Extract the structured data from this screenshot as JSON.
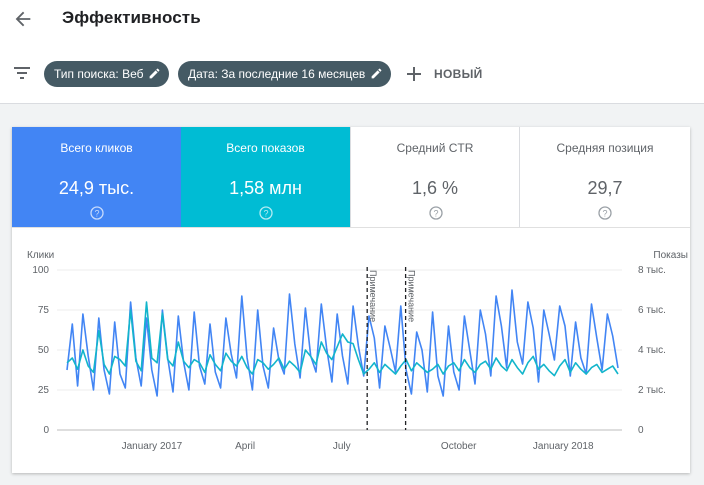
{
  "header": {
    "title": "Эффективность",
    "back_icon": "arrow-back-icon"
  },
  "filters": {
    "chips": [
      {
        "label": "Тип поиска: Веб"
      },
      {
        "label": "Дата: За последние 16 месяцев"
      }
    ],
    "new_label": "НОВЫЙ"
  },
  "metrics": [
    {
      "label": "Всего кликов",
      "value": "24,9 тыс.",
      "color": "#4285f4"
    },
    {
      "label": "Всего показов",
      "value": "1,58 млн",
      "color": "#00bcd4"
    },
    {
      "label": "Средний CTR",
      "value": "1,6 %"
    },
    {
      "label": "Средняя позиция",
      "value": "29,7"
    }
  ],
  "chart_data": {
    "type": "line",
    "left_axis_label": "Клики",
    "right_axis_label": "Показы",
    "left_ticks": [
      "100",
      "75",
      "50",
      "25",
      "0"
    ],
    "right_ticks": [
      "8 тыс.",
      "6 тыс.",
      "4 тыс.",
      "2 тыс.",
      "0"
    ],
    "ylim_left": [
      0,
      100
    ],
    "ylim_right": [
      0,
      8000
    ],
    "x_tick_labels": [
      "January 2017",
      "April",
      "July",
      "October",
      "January 2018"
    ],
    "annotations": [
      "Примечание",
      "Примечание"
    ],
    "grid": true,
    "series": [
      {
        "axis": "right",
        "color": "#4285f4",
        "values_sampled": [
          3000,
          5300,
          2200,
          5800,
          3700,
          2000,
          5600,
          3000,
          1800,
          5400,
          2800,
          2100,
          6400,
          3600,
          2200,
          5600,
          3000,
          1700,
          6000,
          3600,
          1900,
          5700,
          3400,
          2000,
          5900,
          3200,
          2300,
          5300,
          2900,
          2100,
          5600,
          3800,
          2600,
          6700,
          3600,
          2000,
          6000,
          3200,
          2100,
          5100,
          3500,
          2800,
          6800,
          4300,
          2600,
          6100,
          3700,
          2900,
          6300,
          4100,
          2400,
          5800,
          3700,
          2300,
          6200,
          4200,
          2700,
          5700,
          4600,
          2100,
          5200,
          4100,
          2900,
          6200,
          3000,
          1800,
          4900,
          4000,
          1900,
          5900,
          2700,
          1700,
          5200,
          2900,
          2000,
          5700,
          4000,
          2300,
          6000,
          4800,
          2700,
          6700,
          5200,
          3100,
          7000,
          4400,
          3300,
          6400,
          5100,
          2400,
          6000,
          4800,
          3500,
          6200,
          5200,
          2700,
          5400,
          3600,
          2800,
          6300,
          4600,
          3000,
          5800,
          4700,
          3100
        ]
      },
      {
        "axis": "left",
        "color": "#12b5cb",
        "values_sampled": [
          42,
          45,
          38,
          50,
          40,
          36,
          62,
          41,
          35,
          46,
          44,
          40,
          75,
          43,
          37,
          80,
          45,
          42,
          73,
          44,
          40,
          55,
          43,
          39,
          44,
          42,
          36,
          47,
          41,
          37,
          48,
          43,
          40,
          46,
          39,
          35,
          44,
          42,
          38,
          41,
          45,
          38,
          43,
          40,
          36,
          50,
          46,
          41,
          55,
          48,
          44,
          52,
          60,
          55,
          54,
          44,
          35,
          38,
          42,
          36,
          41,
          38,
          35,
          40,
          44,
          37,
          42,
          39,
          36,
          38,
          41,
          35,
          40,
          42,
          37,
          44,
          39,
          36,
          41,
          43,
          38,
          45,
          40,
          37,
          44,
          39,
          35,
          42,
          46,
          38,
          41,
          37,
          34,
          40,
          44,
          36,
          42,
          38,
          35,
          39,
          41,
          36,
          38,
          40,
          35
        ]
      }
    ]
  }
}
